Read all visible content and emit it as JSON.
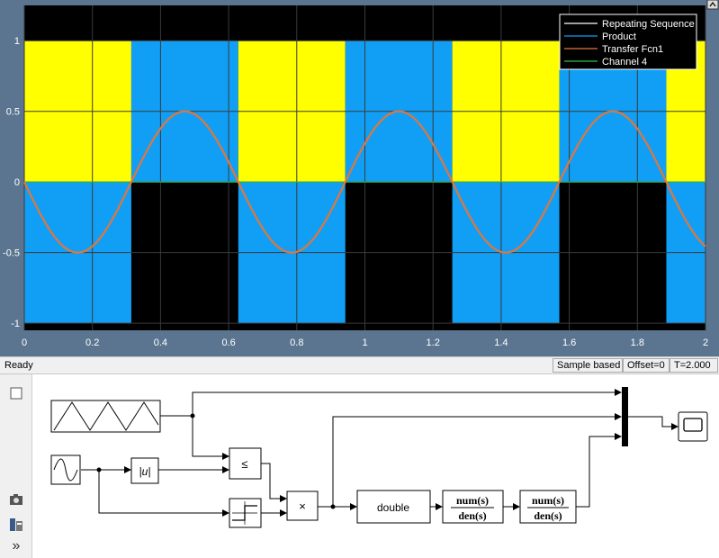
{
  "scope": {
    "chart_data": {
      "type": "line",
      "xlim": [
        0,
        2
      ],
      "ylim": [
        -1.05,
        1.25
      ],
      "xticks": [
        0,
        0.2,
        0.4,
        0.6,
        0.8,
        1,
        1.2,
        1.4,
        1.6,
        1.8,
        2
      ],
      "xtick_labels": [
        "0",
        "0.2",
        "0.4",
        "0.6",
        "0.8",
        "1",
        "1.2",
        "1.4",
        "1.6",
        "1.8",
        "2"
      ],
      "yticks": [
        -1,
        -0.5,
        0,
        0.5,
        1
      ],
      "ytick_labels": [
        "-1",
        "-0.5",
        "0",
        "0.5",
        "1"
      ],
      "grid": true,
      "background": "#000000",
      "legend_position": "top-right",
      "series": [
        {
          "name": "Repeating Sequence",
          "color": "#ffffff",
          "fill_color": "#ffff00",
          "kind": "square_upper",
          "edges": [
            0,
            0.3142,
            0.6283,
            0.9425,
            1.2566,
            1.5708,
            1.885,
            2
          ]
        },
        {
          "name": "Product",
          "color": "#119ff5",
          "fill_color": "#119ff5",
          "kind": "square_lower",
          "edges": [
            0,
            0.3142,
            0.6283,
            0.9425,
            1.2566,
            1.5708,
            1.885,
            2
          ]
        },
        {
          "name": "Transfer Fcn1",
          "color": "#e0763c",
          "kind": "sine",
          "amplitude": -0.5,
          "frequency_rad_per_s": 10
        },
        {
          "name": "Channel 4",
          "color": "#2fbe4e",
          "kind": "constant",
          "value": 0
        }
      ]
    }
  },
  "status_bar": {
    "ready": "Ready",
    "mode": "Sample based",
    "offset": "Offset=0",
    "time": "T=2.000"
  },
  "diagram": {
    "blocks": {
      "product_symbol": "×",
      "relational_symbol": "≤",
      "abs_symbol": "|u|",
      "conversion_label": "double",
      "tf1_num": "num(s)",
      "tf1_den": "den(s)",
      "tf2_num": "num(s)",
      "tf2_den": "den(s)"
    }
  },
  "palette": {
    "icons": [
      "square-icon",
      "camera-icon",
      "library-icon",
      "more-icon"
    ],
    "more_glyph": "»"
  }
}
